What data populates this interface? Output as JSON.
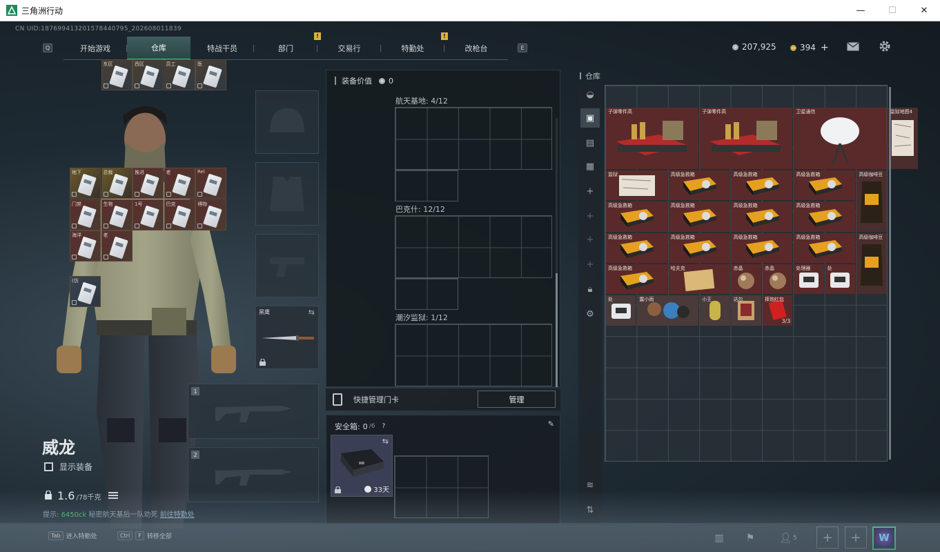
{
  "window": {
    "title": "三角洲行动",
    "minimize": "—",
    "maximize": "☐",
    "close": "✕"
  },
  "uid_text": "CN UID:1876994132015784407​95_202608011839",
  "nav": {
    "key_left": "Q",
    "key_right": "E",
    "tabs": [
      {
        "label": "开始游戏"
      },
      {
        "label": "仓库",
        "active": true
      },
      {
        "label": "特战干员"
      },
      {
        "label": "部门",
        "alert": "!"
      },
      {
        "label": "交易行"
      },
      {
        "label": "特勤处",
        "alert": "!"
      },
      {
        "label": "改枪台"
      }
    ]
  },
  "currency": {
    "coins": "207,925",
    "tickets": "394",
    "add": "+"
  },
  "icons": {
    "mail": "mail-icon",
    "settings": "gear-icon"
  },
  "character": {
    "name": "威龙",
    "show_gear_label": "显示装备",
    "weight_value": "1.6",
    "weight_unit": "/78千克",
    "status_prefix": "提示:",
    "status_green": "6450ck",
    "status_text": "秘密航天基后一队劝死",
    "status_link": "前往特勤处"
  },
  "slots": {
    "melee_label": "黑鹰",
    "weapon1_num": "1",
    "weapon2_num": "2"
  },
  "equip_value": {
    "label": "装备价值",
    "value": "0"
  },
  "keycard_sections": [
    {
      "title": "航天基地: 4/12",
      "cards": [
        "东区",
        "西区",
        "员工",
        "医"
      ]
    },
    {
      "title": "巴克什: 12/12",
      "cards": [
        "地下",
        "总裁",
        "推进",
        "老",
        "Rel",
        "门禁",
        "生物",
        "1号",
        "巴克",
        "博物",
        "海洋",
        "老"
      ]
    },
    {
      "title": "潮汐监狱: 1/12",
      "cards": [
        "(仿"
      ]
    }
  ],
  "quick_manage": {
    "label": "快捷管理门卡",
    "button": "管理"
  },
  "safebox": {
    "label": "安全箱:",
    "count": "0",
    "capacity": "/6",
    "help": "?",
    "duration": "33天"
  },
  "warehouse": {
    "title": "仓库",
    "items": [
      {
        "label": "子弹零件高"
      },
      {
        "label": "子弹零件高"
      },
      {
        "label": "卫星通信"
      },
      {
        "label": "监狱地图4"
      },
      {
        "label": "监狱"
      },
      {
        "label": "高级急救箱"
      },
      {
        "label": "高级急救箱"
      },
      {
        "label": "高级急救箱"
      },
      {
        "label": "高级咖啡豆"
      },
      {
        "label": "高级急救箱"
      },
      {
        "label": "高级急救箱"
      },
      {
        "label": "高级急救箱"
      },
      {
        "label": "高级急救箱"
      },
      {
        "label": "高级急救箱"
      },
      {
        "label": "高级急救箱"
      },
      {
        "label": "高级急救箱"
      },
      {
        "label": "高级急救箱"
      },
      {
        "label": "高级咖啡豆"
      },
      {
        "label": "高级急救箱"
      },
      {
        "label": "哈夫克"
      },
      {
        "label": "赤晶"
      },
      {
        "label": "赤晶"
      },
      {
        "label": "处理器"
      },
      {
        "label": "处"
      },
      {
        "label": "处"
      },
      {
        "label": "露小雨"
      },
      {
        "label": "小王"
      },
      {
        "label": "达尔"
      },
      {
        "label": "摔炮红包",
        "count": "3/3"
      }
    ]
  },
  "bottom": {
    "tab_key": "Tab",
    "tab_label": "进入特勤处",
    "ctrl_key": "Ctrl",
    "f_key": "F",
    "transfer_label": "转移全部",
    "friends_count": "5"
  }
}
